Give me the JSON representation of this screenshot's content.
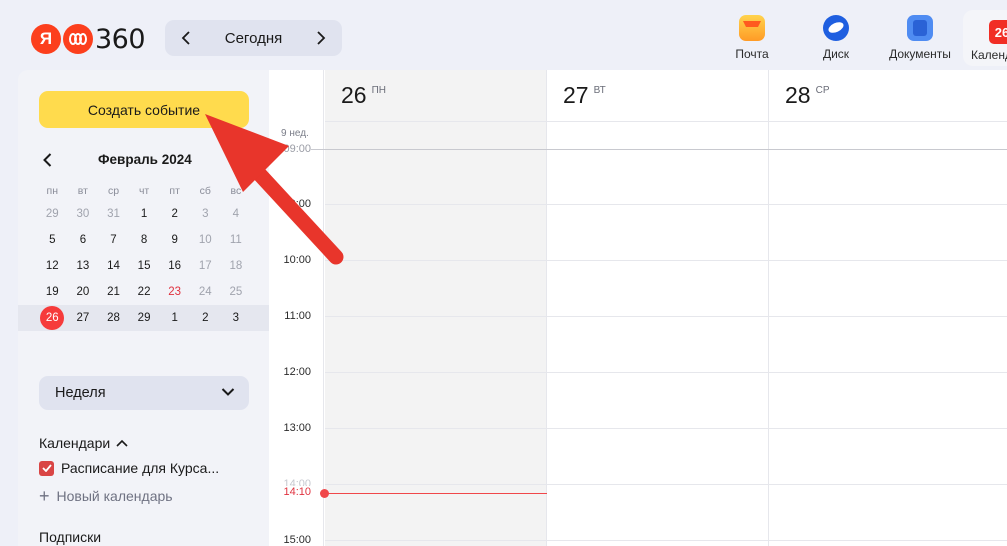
{
  "header": {
    "logo_ya": "Я",
    "logo_text": "360",
    "today_button": "Сегодня",
    "apps": [
      {
        "label": "Почта",
        "icon": "mail-icon"
      },
      {
        "label": "Диск",
        "icon": "disk-icon"
      },
      {
        "label": "Документы",
        "icon": "docs-icon"
      }
    ],
    "calendar_app": {
      "label": "Календарь",
      "badge": "26"
    }
  },
  "sidebar": {
    "create_button": "Создать событие",
    "mini_calendar": {
      "month": "Февраль 2024",
      "weekdays": [
        "пн",
        "вт",
        "ср",
        "чт",
        "пт",
        "сб",
        "вс"
      ],
      "rows": [
        [
          "29",
          "30",
          "31",
          "1",
          "2",
          "3",
          "4"
        ],
        [
          "5",
          "6",
          "7",
          "8",
          "9",
          "10",
          "11"
        ],
        [
          "12",
          "13",
          "14",
          "15",
          "16",
          "17",
          "18"
        ],
        [
          "19",
          "20",
          "21",
          "22",
          "23",
          "24",
          "25"
        ],
        [
          "26",
          "27",
          "28",
          "29",
          "1",
          "2",
          "3"
        ]
      ],
      "today": "26",
      "holiday": "23"
    },
    "view_select": "Неделя",
    "calendars_title": "Календари",
    "calendar_item": "Расписание для Курса...",
    "new_calendar": "Новый календарь",
    "subscriptions_title": "Подписки"
  },
  "main": {
    "week_label": "9 нед.",
    "days": [
      {
        "num": "26",
        "wd": "ПН"
      },
      {
        "num": "27",
        "wd": "ВТ"
      },
      {
        "num": "28",
        "wd": "СР"
      }
    ],
    "partial_top_label": "09:00",
    "hours": [
      "9:00",
      "10:00",
      "11:00",
      "12:00",
      "13:00",
      "14:00",
      "15:00"
    ],
    "now_time": "14:10"
  },
  "colors": {
    "accent_yellow": "#ffdb4d",
    "today_red": "#f63b3b",
    "now_line": "#f0474a",
    "annotation_arrow": "#e8352b"
  }
}
